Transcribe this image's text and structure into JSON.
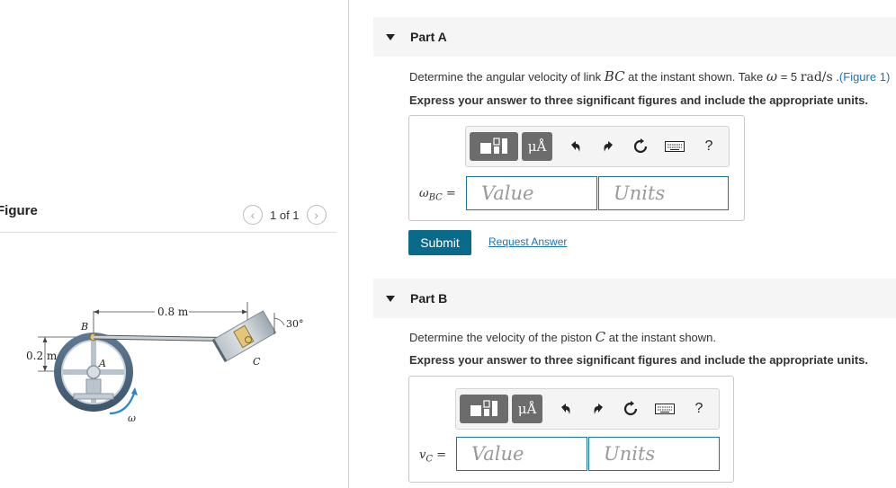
{
  "figure_panel": {
    "title": "Figure",
    "pager_text": "1 of 1",
    "labels": {
      "length": "0.8 m",
      "height": "0.2 m",
      "angle": "30°",
      "point_b": "B",
      "point_a": "A",
      "point_c": "C",
      "omega": "ω"
    }
  },
  "part_a": {
    "title": "Part A",
    "question_pre": "Determine the angular velocity of link ",
    "question_sym": "BC",
    "question_mid": " at the instant shown. Take ",
    "question_omega": "ω",
    "question_eq": " = 5 ",
    "question_unit": "rad/s",
    "question_dot": " .",
    "figure_link": "(Figure 1)",
    "instruction": "Express your answer to three significant figures and include the appropriate units.",
    "var_symbol": "ω",
    "var_sub": "BC",
    "value_placeholder": "Value",
    "units_placeholder": "Units",
    "submit_label": "Submit",
    "request_label": "Request Answer"
  },
  "part_b": {
    "title": "Part B",
    "question_pre": "Determine the velocity of the piston ",
    "question_sym": "C",
    "question_post": " at the instant shown.",
    "instruction": "Express your answer to three significant figures and include the appropriate units.",
    "var_symbol": "v",
    "var_sub": "C",
    "value_placeholder": "Value",
    "units_placeholder": "Units"
  },
  "toolbar": {
    "mu_label": "μÅ",
    "help_label": "?",
    "icons": [
      "templates-icon",
      "symbols-icon",
      "undo-icon",
      "redo-icon",
      "reset-icon",
      "keyboard-icon",
      "help-icon"
    ]
  }
}
